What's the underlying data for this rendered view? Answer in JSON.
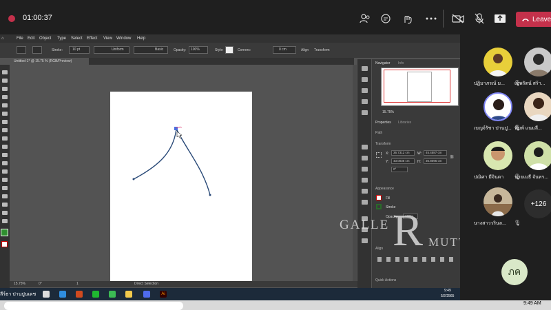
{
  "meeting": {
    "timer": "01:00:37",
    "leave_label": "Leave"
  },
  "illustrator": {
    "menu": [
      "File",
      "Edit",
      "Object",
      "Type",
      "Select",
      "Effect",
      "View",
      "Window",
      "Help"
    ],
    "control_bar": {
      "stroke_label": "Stroke:",
      "stroke_weight": "10 pt",
      "profile_uniform": "Uniform",
      "brush_basic": "Basic",
      "opacity_label": "Opacity:",
      "opacity_value": "100%",
      "style_label": "Style:",
      "corners_label": "Corners:",
      "corners_value": "0 cm",
      "align_label": "Align",
      "transform_label": "Transform"
    },
    "doc_tab": "Untitled-1* @ 15.75 % (RGB/Preview)",
    "anchor_label": "path",
    "status": {
      "zoom": "15.75%",
      "rotation": "0°",
      "artboard": "1",
      "mode": "Direct Selection"
    },
    "panel": {
      "navigator_tab": "Navigator",
      "info_tab": "Info",
      "nav_zoom": "15.75%",
      "properties_tab": "Properties",
      "libraries_tab": "Libraries",
      "path_label": "Path",
      "transform_label": "Transform",
      "x_label": "X:",
      "x_value": "36.7312 cm",
      "w_label": "W:",
      "w_value": "45.4587 cm",
      "y_label": "Y:",
      "y_value": "43.0036 cm",
      "h_label": "H:",
      "h_value": "36.8096 cm",
      "angle": "0°",
      "appearance_label": "Appearance",
      "fill_label": "Fill",
      "stroke_label": "Stroke",
      "opacity_label": "Opacity",
      "opacity_value": "100%",
      "align_label": "Align",
      "quick_actions_label": "Quick Actions"
    }
  },
  "windows_taskbar": {
    "user_text": "ลีร์ธา ปานปูนเดช",
    "time": "9:49",
    "date": "5/2/2565"
  },
  "watermark": {
    "left": "GALLE",
    "big": "R",
    "right": "MUTT"
  },
  "participants": [
    {
      "name": "ปฏิมาภรณ์ ม..."
    },
    {
      "name": "เทพรัตน์ สร้า..."
    },
    {
      "name": "เบญจ์รัชา ปานปู..."
    },
    {
      "name": "พิมพ์ แนมลี..."
    },
    {
      "name": "ปณิศา มีจินดา"
    },
    {
      "name": "นายเมธี จันทร..."
    },
    {
      "name": "นางสาววรินล..."
    }
  ],
  "more_count": "+126",
  "my_initials": "ภค",
  "host_taskbar": {
    "time": "9:49 AM"
  },
  "colors": {
    "leave": "#c4314b",
    "path": "#2a4a78",
    "teams_bg": "#1f1f1f"
  }
}
